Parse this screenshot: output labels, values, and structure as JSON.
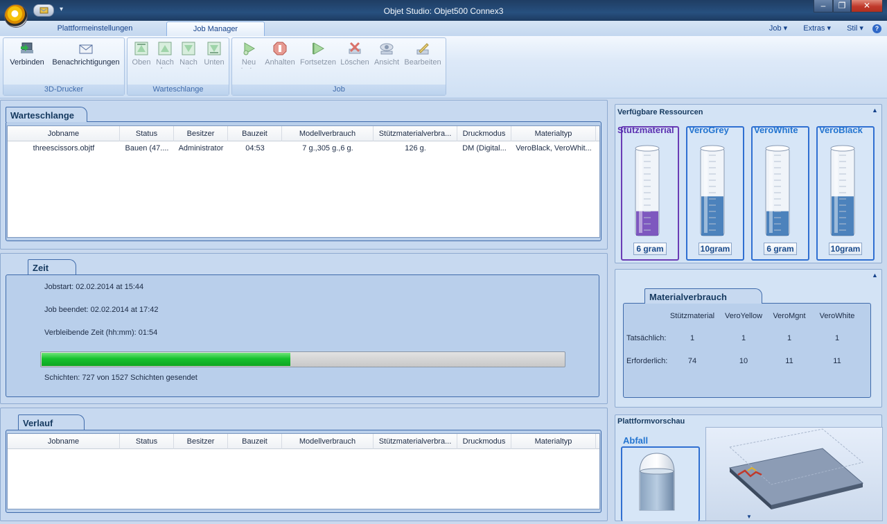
{
  "window": {
    "title": "Objet Studio: Objet500 Connex3",
    "min": "–",
    "max": "❐",
    "close": "✕"
  },
  "tabs": [
    {
      "label": "Plattformeinstellungen"
    },
    {
      "label": "Job Manager"
    }
  ],
  "menu": {
    "job": "Job",
    "extras": "Extras",
    "stil": "Stil",
    "help": "?"
  },
  "ribbon": {
    "groups": [
      {
        "label": "3D-Drucker"
      },
      {
        "label": "Warteschlange"
      },
      {
        "label": "Job"
      }
    ],
    "buttons": [
      {
        "label": "Verbinden",
        "icon": "connect-icon"
      },
      {
        "label": "Benachrichtigungen",
        "icon": "envelope-icon"
      },
      {
        "label": "Oben",
        "icon": "move-top-icon"
      },
      {
        "label": "Nach oben",
        "icon": "move-up-icon"
      },
      {
        "label": "Nach unten",
        "icon": "move-down-icon"
      },
      {
        "label": "Unten",
        "icon": "move-bottom-icon"
      },
      {
        "label": "Neu starten",
        "icon": "restart-icon"
      },
      {
        "label": "Anhalten",
        "icon": "stop-icon"
      },
      {
        "label": "Fortsetzen",
        "icon": "resume-icon"
      },
      {
        "label": "Löschen",
        "icon": "delete-icon"
      },
      {
        "label": "Ansicht",
        "icon": "view-icon"
      },
      {
        "label": "Bearbeiten",
        "icon": "edit-icon"
      }
    ]
  },
  "queue": {
    "title": "Warteschlange",
    "columns": [
      "Jobname",
      "Status",
      "Besitzer",
      "Bauzeit",
      "Modellverbrauch",
      "Stützmaterialverbra...",
      "Druckmodus",
      "Materialtyp"
    ],
    "rows": [
      [
        "threescissors.objtf",
        "Bauen (47....",
        "Administrator",
        "04:53",
        "7 g.,305 g.,6 g.",
        "126 g.",
        "DM (Digital...",
        "VeroBlack, VeroWhit..."
      ]
    ]
  },
  "time": {
    "title": "Zeit",
    "jobstart": "Jobstart:  02.02.2014 at 15:44",
    "jobend": "Job beendet: 02.02.2014 at 17:42",
    "remaining": "Verbleibende Zeit (hh:mm):     01:54",
    "progress_fraction": 0.476,
    "layers": "Schichten: 727 von 1527 Schichten gesendet"
  },
  "history": {
    "title": "Verlauf",
    "columns": [
      "Jobname",
      "Status",
      "Besitzer",
      "Bauzeit",
      "Modellverbrauch",
      "Stützmaterialverbra...",
      "Druckmodus",
      "Materialtyp"
    ]
  },
  "resources": {
    "title": "Verfügbare Ressourcen",
    "items": [
      {
        "name": "Stützmaterial",
        "amount": "6 gram",
        "level": 0.28,
        "color": "#6a3cb5"
      },
      {
        "name": "VeroGrey",
        "amount": "10gram",
        "level": 0.45,
        "color": "#2f6db1"
      },
      {
        "name": "VeroWhite",
        "amount": "6 gram",
        "level": 0.28,
        "color": "#2f6db1"
      },
      {
        "name": "VeroBlack",
        "amount": "10gram",
        "level": 0.45,
        "color": "#2f6db1"
      }
    ]
  },
  "consumption": {
    "title": "Materialverbrauch",
    "columns": [
      "Stützmaterial",
      "VeroYellow",
      "VeroMgnt",
      "VeroWhite"
    ],
    "rows": [
      {
        "label": "Tatsächlich:",
        "values": [
          "1",
          "1",
          "1",
          "1"
        ]
      },
      {
        "label": "Erforderlich:",
        "values": [
          "74",
          "10",
          "11",
          "11"
        ]
      }
    ]
  },
  "preview": {
    "title": "Plattformvorschau",
    "waste_label": "Abfall"
  }
}
